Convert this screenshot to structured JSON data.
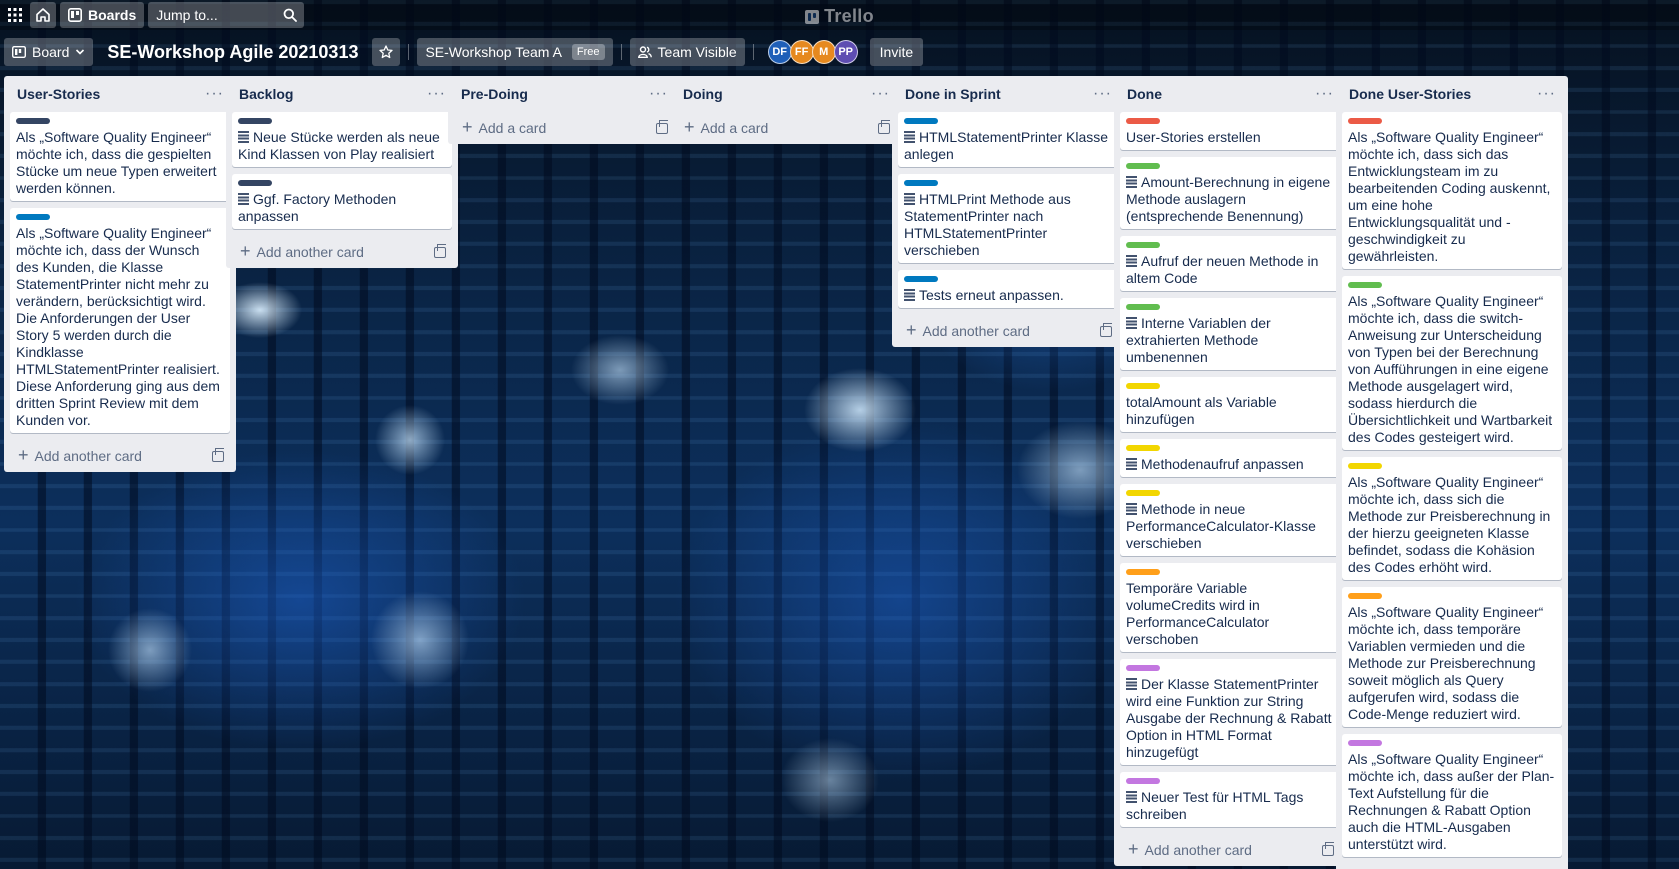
{
  "header": {
    "boards_label": "Boards",
    "jump_placeholder": "Jump to...",
    "logo_text": "Trello"
  },
  "board": {
    "view_label": "Board",
    "title": "SE-Workshop Agile 20210313",
    "team_name": "SE-Workshop Team A",
    "team_badge": "Free",
    "visibility": "Team Visible",
    "invite_label": "Invite",
    "members": [
      {
        "initials": "DF",
        "color": "#1f5fb8"
      },
      {
        "initials": "FF",
        "color": "#e6891f"
      },
      {
        "initials": "M",
        "color": "#e6891f"
      },
      {
        "initials": "PP",
        "color": "#5e4db2"
      }
    ]
  },
  "labels": {
    "dark": "#344563",
    "blue": "#0079bf",
    "red": "#eb5a46",
    "green": "#61bd4f",
    "yellow": "#f2d600",
    "orange": "#ff9f1a",
    "purple": "#c377e0"
  },
  "lists": [
    {
      "title": "User-Stories",
      "add_label": "Add another card",
      "cards": [
        {
          "label": "dark",
          "text": "Als „Software Quality Engineer“ möchte ich, dass die gespielten Stücke um neue Typen erweitert werden können."
        },
        {
          "label": "blue",
          "text": "Als „Software Quality Engineer“ möchte ich, dass der Wunsch des Kunden, die Klasse StatementPrinter nicht mehr zu verändern, berücksichtigt wird. Die Anforderungen der User Story 5 werden durch die Kindklasse HTMLStatementPrinter realisiert. Diese Anforderung ging aus dem dritten Sprint Review mit dem Kunden vor."
        }
      ]
    },
    {
      "title": "Backlog",
      "add_label": "Add another card",
      "cards": [
        {
          "label": "dark",
          "text": "Neue Stücke werden als neue Kind Klassen von Play realisiert"
        },
        {
          "label": "dark",
          "text": "Ggf. Factory Methoden anpassen"
        }
      ]
    },
    {
      "title": "Pre-Doing",
      "add_label": "Add a card",
      "cards": []
    },
    {
      "title": "Doing",
      "add_label": "Add a card",
      "cards": []
    },
    {
      "title": "Done in Sprint",
      "add_label": "Add another card",
      "cards": [
        {
          "label": "blue",
          "text": "HTMLStatementPrinter Klasse anlegen"
        },
        {
          "label": "blue",
          "text": "HTMLPrint Methode aus StatementPrinter nach HTMLStatementPrinter verschieben"
        },
        {
          "label": "blue",
          "text": "Tests erneut anpassen."
        }
      ]
    },
    {
      "title": "Done",
      "add_label": "Add another card",
      "cards": [
        {
          "label": "red",
          "text": "User-Stories erstellen"
        },
        {
          "label": "green",
          "text": "Amount-Berechnung in eigene Methode auslagern (entsprechende Benennung)"
        },
        {
          "label": "green",
          "text": "Aufruf der neuen Methode in altem Code"
        },
        {
          "label": "green",
          "text": "Interne Variablen der extrahierten Methode umbenennen"
        },
        {
          "label": "yellow",
          "text": "totalAmount als Variable hinzufügen"
        },
        {
          "label": "yellow",
          "text": "Methodenaufruf anpassen"
        },
        {
          "label": "yellow",
          "text": "Methode in neue PerformanceCalculator-Klasse verschieben"
        },
        {
          "label": "orange",
          "text": "Temporäre Variable volumeCredits wird in PerformanceCalculator verschoben"
        },
        {
          "label": "purple",
          "text": "Der Klasse StatementPrinter wird eine Funktion zur String Ausgabe der Rechnung & Rabatt Option in HTML Format hinzugefügt"
        },
        {
          "label": "purple",
          "text": "Neuer Test für HTML Tags schreiben"
        }
      ]
    },
    {
      "title": "Done User-Stories",
      "add_label": "Add another card",
      "cards": [
        {
          "label": "red",
          "text": "Als „Software Quality Engineer“ möchte ich, dass sich das Entwicklungsteam im zu bearbeitenden Coding auskennt, um eine hohe Entwicklungsqualität und -geschwindigkeit zu gewährleisten."
        },
        {
          "label": "green",
          "text": "Als „Software Quality Engineer“ möchte ich, dass die switch-Anweisung zur Unterscheidung von Typen bei der Berechnung von Aufführungen in eine eigene Methode ausgelagert wird, sodass hierdurch die Übersichtlichkeit und Wartbarkeit des Codes gesteigert wird."
        },
        {
          "label": "yellow",
          "text": "Als „Software Quality Engineer“ möchte ich, dass sich die Methode zur Preisberechnung in der hierzu geeigneten Klasse befindet, sodass die Kohäsion des Codes erhöht wird."
        },
        {
          "label": "orange",
          "text": "Als „Software Quality Engineer“ möchte ich, dass temporäre Variablen vermieden und die Methode zur Preisberechnung soweit möglich als Query aufgerufen wird, sodass die Code-Menge reduziert wird."
        },
        {
          "label": "purple",
          "text": "Als „Software Quality Engineer“ möchte ich, dass außer der Plan-Text Aufstellung für die Rechnungen & Rabatt Option auch die HTML-Ausgaben unterstützt wird."
        }
      ]
    }
  ]
}
